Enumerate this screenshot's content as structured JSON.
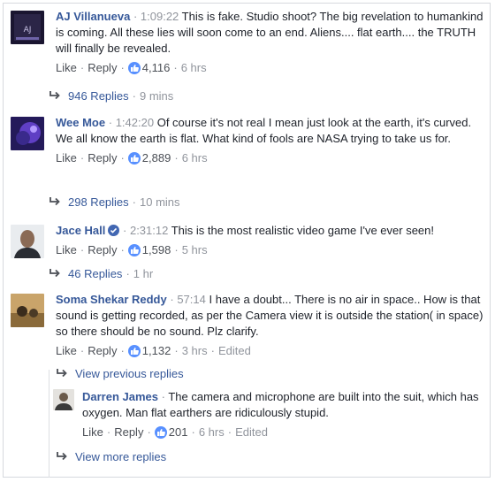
{
  "comments": [
    {
      "name": "AJ Villanueva",
      "time": "1:09:22",
      "text": "This is fake. Studio shoot? The big revelation to humankind is coming. All these lies will soon come to an end. Aliens.... flat earth.... the TRUTH will finally be revealed.",
      "like_label": "Like",
      "reply_label": "Reply",
      "likes": "4,116",
      "age": "6 hrs",
      "replies": "946 Replies",
      "replies_age": "9 mins"
    },
    {
      "name": "Wee Moe",
      "time": "1:42:20",
      "text": "Of course it's not real I mean just look at the earth, it's curved. We all know the earth is flat. What kind of fools are NASA trying to take us for.",
      "like_label": "Like",
      "reply_label": "Reply",
      "likes": "2,889",
      "age": "6 hrs",
      "replies": "298 Replies",
      "replies_age": "10 mins"
    },
    {
      "name": "Jace Hall",
      "time": "2:31:12",
      "text": "This is the most realistic video game I've ever seen!",
      "like_label": "Like",
      "reply_label": "Reply",
      "likes": "1,598",
      "age": "5 hrs",
      "replies": "46 Replies",
      "replies_age": "1 hr"
    },
    {
      "name": "Soma Shekar Reddy",
      "time": "57:14",
      "text": "I have a doubt... There is no air in space.. How is that sound is getting recorded, as per the Camera view it is outside the station( in space) so there should be no sound. Plz clarify.",
      "like_label": "Like",
      "reply_label": "Reply",
      "likes": "1,132",
      "age": "3 hrs",
      "edited": "Edited"
    }
  ],
  "view_previous": "View previous replies",
  "reply": {
    "name": "Darren James",
    "text": "The camera and microphone are built into the suit, which has oxygen. Man flat earthers are ridiculously stupid.",
    "like_label": "Like",
    "reply_label": "Reply",
    "likes": "201",
    "age": "6 hrs",
    "edited": "Edited"
  },
  "view_more": "View more replies",
  "colors": {
    "name": "#365899",
    "meta": "#90949c",
    "like_badge": "#5890ff"
  },
  "icons": [
    "like-thumb-icon",
    "reply-arrow-icon",
    "verified-badge-icon"
  ]
}
